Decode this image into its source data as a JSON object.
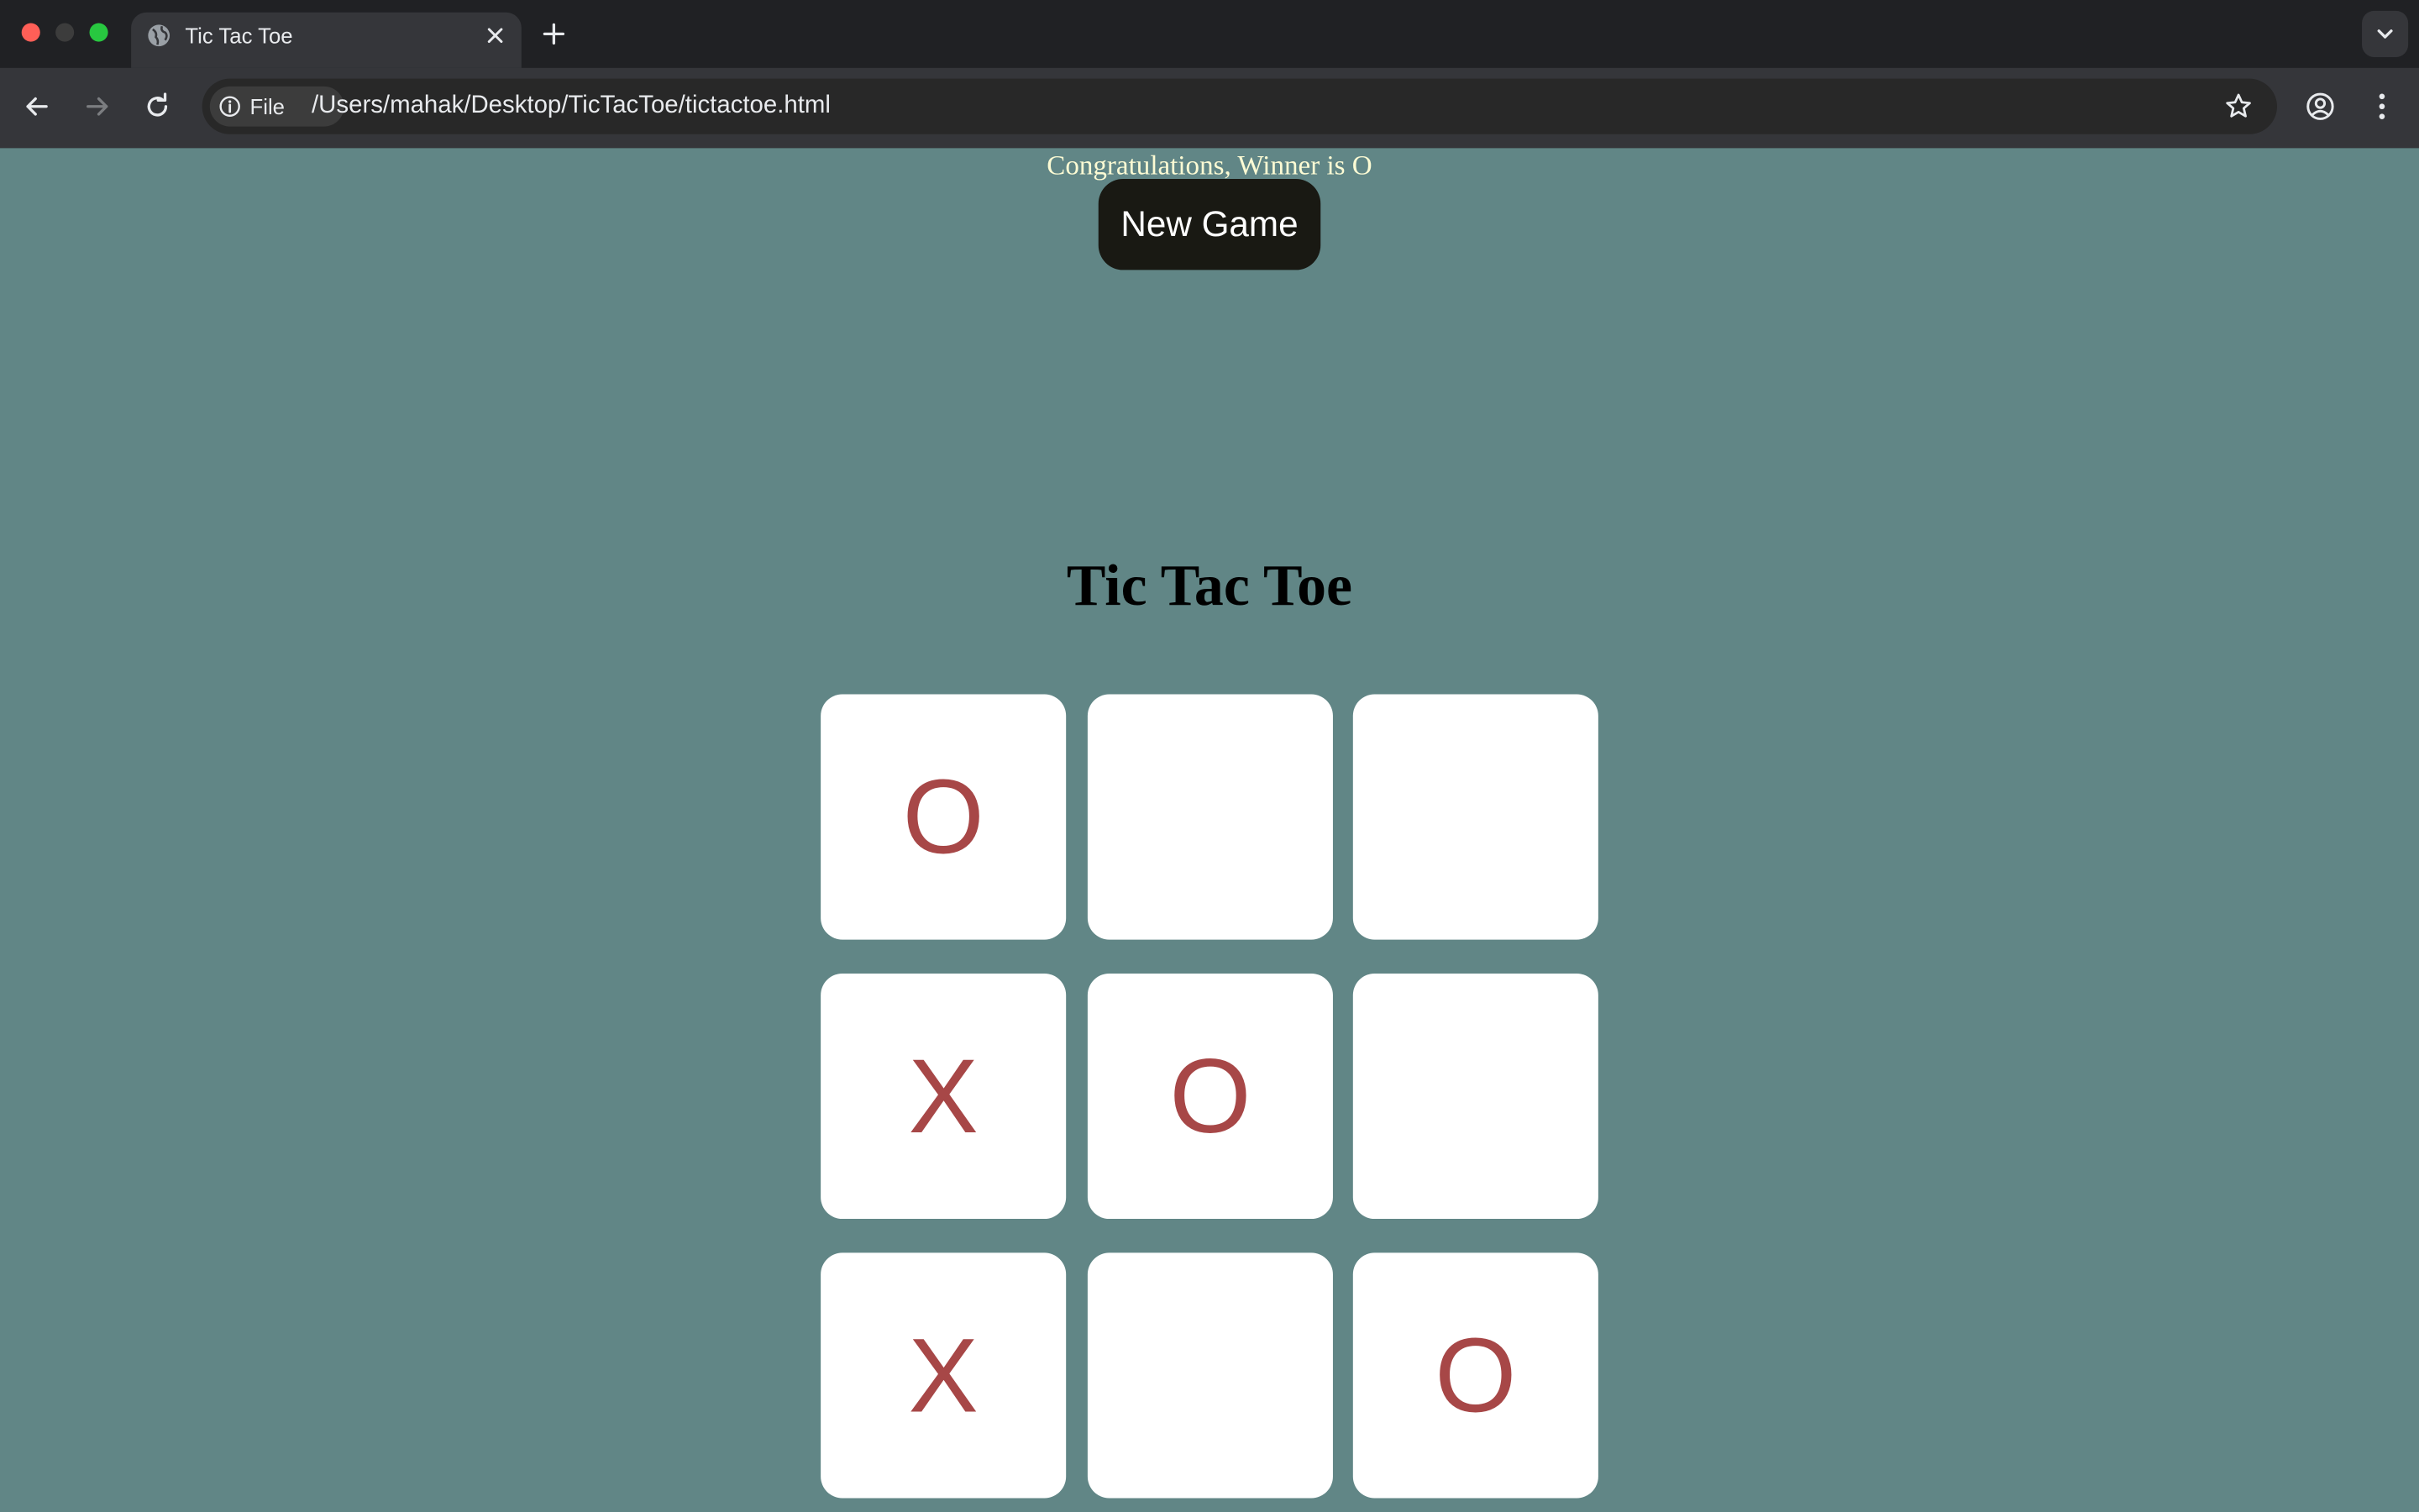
{
  "browser": {
    "tab_title": "Tic Tac Toe",
    "url": "/Users/mahak/Desktop/TicTacToe/tictactoe.html",
    "site_chip_label": "File"
  },
  "page": {
    "winner_message": "Congratulations, Winner is O",
    "new_game_label": "New Game",
    "title": "Tic Tac Toe",
    "board": [
      "O",
      "",
      "",
      "X",
      "O",
      "",
      "X",
      "",
      "O"
    ]
  },
  "colors": {
    "page_background": "#618686",
    "mark_color": "#a74747",
    "winner_text": "#fcfbd4",
    "button_background": "#191913"
  }
}
